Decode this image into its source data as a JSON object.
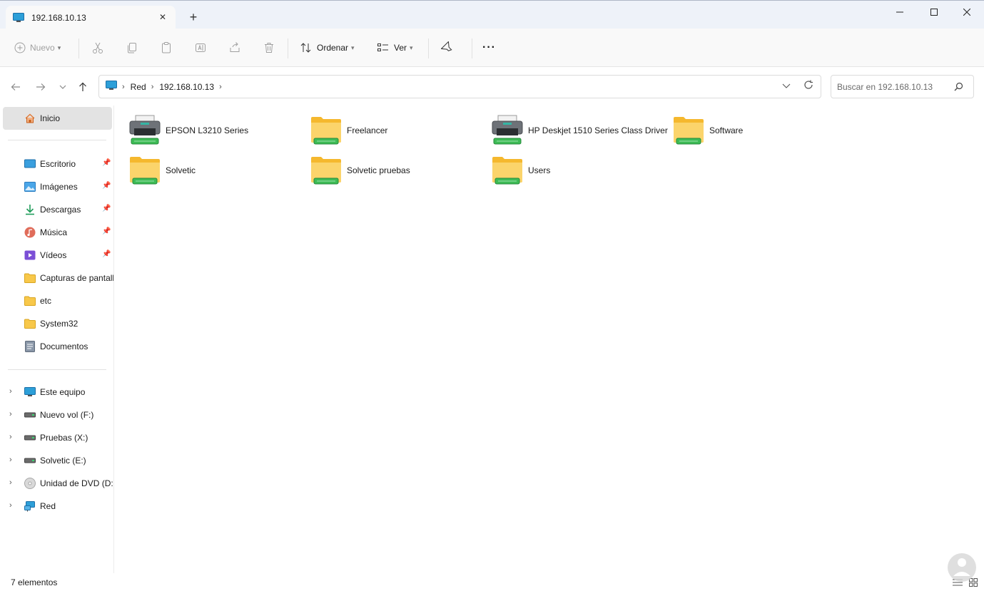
{
  "window": {
    "tab_title": "192.168.10.13",
    "tab_close": "✕",
    "new_tab": "+"
  },
  "commandbar": {
    "new_label": "Nuevo",
    "sort_label": "Ordenar",
    "view_label": "Ver",
    "more_label": "···"
  },
  "address": {
    "crumbs": [
      "Red",
      "192.168.10.13"
    ],
    "search_placeholder": "Buscar en 192.168.10.13"
  },
  "sidebar": {
    "home": "Inicio",
    "quick_access": [
      {
        "label": "Escritorio",
        "icon": "desktop-icon",
        "pinned": true
      },
      {
        "label": "Imágenes",
        "icon": "pictures-icon",
        "pinned": true
      },
      {
        "label": "Descargas",
        "icon": "downloads-icon",
        "pinned": true
      },
      {
        "label": "Música",
        "icon": "music-icon",
        "pinned": true
      },
      {
        "label": "Vídeos",
        "icon": "videos-icon",
        "pinned": true
      },
      {
        "label": "Capturas de pantalla",
        "icon": "folder-icon",
        "pinned": false
      },
      {
        "label": "etc",
        "icon": "folder-icon",
        "pinned": false
      },
      {
        "label": "System32",
        "icon": "folder-icon",
        "pinned": false
      },
      {
        "label": "Documentos",
        "icon": "documents-icon",
        "pinned": false
      }
    ],
    "devices": [
      {
        "label": "Este equipo",
        "icon": "this-pc-icon"
      },
      {
        "label": "Nuevo vol (F:)",
        "icon": "drive-icon"
      },
      {
        "label": "Pruebas (X:)",
        "icon": "drive-icon"
      },
      {
        "label": "Solvetic (E:)",
        "icon": "drive-icon"
      },
      {
        "label": "Unidad de DVD (D:)",
        "icon": "dvd-icon"
      },
      {
        "label": "Red",
        "icon": "network-icon"
      }
    ]
  },
  "items": [
    {
      "name": "EPSON L3210 Series",
      "type": "printer"
    },
    {
      "name": "Freelancer",
      "type": "share"
    },
    {
      "name": "HP Deskjet 1510 Series Class Driver",
      "type": "printer"
    },
    {
      "name": "Software",
      "type": "share"
    },
    {
      "name": "Solvetic",
      "type": "share"
    },
    {
      "name": "Solvetic pruebas",
      "type": "share"
    },
    {
      "name": "Users",
      "type": "share"
    }
  ],
  "status": {
    "count": "7 elementos"
  },
  "colors": {
    "titlebar": "#eef2f9",
    "folder": "#f8c84a",
    "share_bar": "#2fb34a",
    "selected": "#e3e3e3"
  }
}
